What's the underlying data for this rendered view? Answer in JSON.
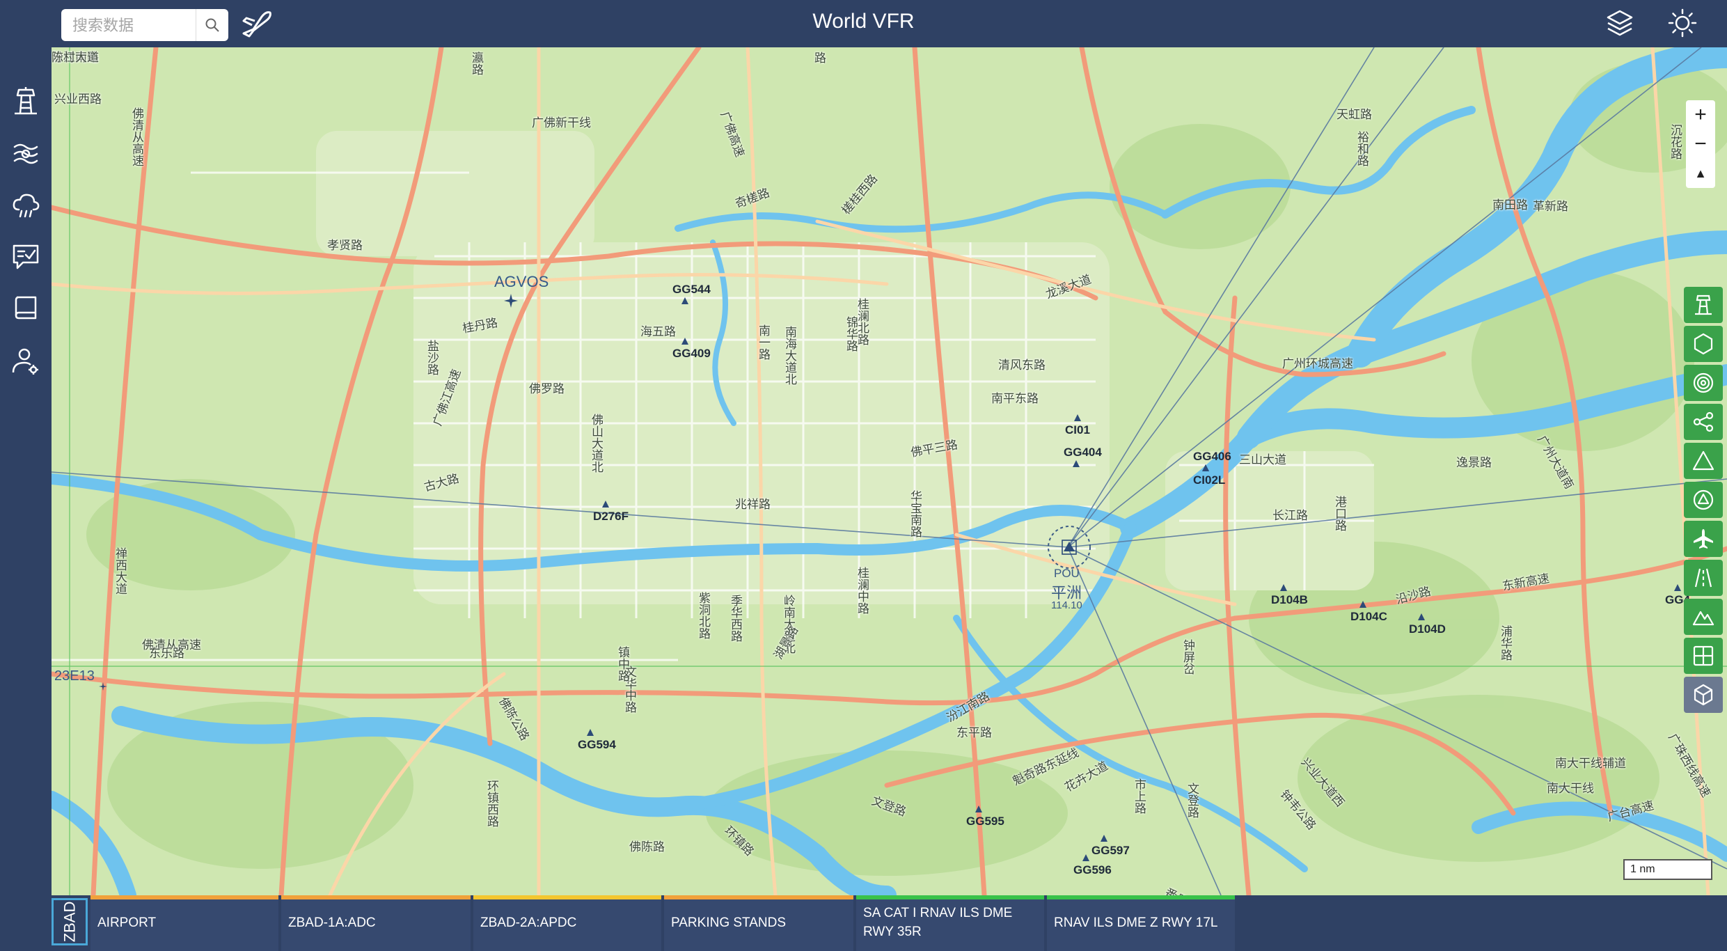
{
  "app": {
    "title": "World VFR"
  },
  "search": {
    "placeholder": "搜索数据"
  },
  "icons": {
    "search": "search-icon",
    "flight_plan": "plane-icon",
    "layers": "layers-icon",
    "theme": "sun-icon",
    "nav": [
      "airport-tower-icon",
      "weather-wind-icon",
      "cloud-rain-icon",
      "notes-check-icon",
      "book-icon",
      "user-settings-icon"
    ],
    "right_tools": [
      "tower-icon",
      "hexagon-icon",
      "target-icon",
      "share-nodes-icon",
      "triangle-icon",
      "triangle-circle-icon",
      "airplane-icon",
      "runway-icon",
      "mountain-icon",
      "grid-icon",
      "cube-icon"
    ]
  },
  "map": {
    "zoom_in": "+",
    "zoom_out": "−",
    "compass": "▲",
    "scale": "1 nm",
    "waypoints": [
      {
        "id": "AGVOS",
        "type": "intersection"
      },
      {
        "id": "GG544",
        "type": "vor"
      },
      {
        "id": "GG409",
        "type": "vor"
      },
      {
        "id": "D276F",
        "type": "dme"
      },
      {
        "id": "CI01",
        "type": "fix"
      },
      {
        "id": "GG404",
        "type": "fix"
      },
      {
        "id": "GG406",
        "type": "fix"
      },
      {
        "id": "CI02L",
        "type": "fix"
      },
      {
        "id": "D104B",
        "type": "dme"
      },
      {
        "id": "D104C",
        "type": "dme"
      },
      {
        "id": "D104D",
        "type": "dme"
      },
      {
        "id": "GG594",
        "type": "fix"
      },
      {
        "id": "GG595",
        "type": "fix"
      },
      {
        "id": "GG597",
        "type": "fix"
      },
      {
        "id": "GG596",
        "type": "fix"
      },
      {
        "id": "23E13",
        "type": "grid"
      },
      {
        "id": "GG4",
        "type": "fix"
      }
    ],
    "navaid": {
      "ident": "POU",
      "name": "平洲",
      "freq": "114.10"
    },
    "roads": [
      "兴业西路",
      "佛清从高速",
      "广佛新干线",
      "瀛路",
      "路",
      "广佛高速",
      "奇槎路",
      "槎桂西路",
      "孝贤路",
      "桂丹路",
      "海五路",
      "南一路",
      "南海大道北",
      "桂澜北路",
      "锦华路",
      "龙溪大道",
      "清风东路",
      "南平东路",
      "广州环城高速",
      "佛罗路",
      "佛山大道北",
      "佛平三路",
      "三山大道",
      "长江路",
      "港口路",
      "古大路",
      "兆祥路",
      "华宝南路",
      "桂澜中路",
      "广佛江高速",
      "盐沙路",
      "禅西大道",
      "佛清从高速",
      "紫洞北路",
      "季华西路",
      "岭南大道北",
      "文华中路",
      "湖景路",
      "汾江南路",
      "东平路",
      "魁奇路东延线",
      "花卉大道",
      "文登路",
      "文登路",
      "环镇路",
      "佛陈路",
      "天虹路",
      "裕和路",
      "南田路",
      "革新路",
      "沉花路",
      "逸景路",
      "广州大道南",
      "浦华路",
      "沿沙路",
      "东新高速",
      "南大干线辅道",
      "南大干线",
      "兴业大道西",
      "钟韦公路",
      "广台高速",
      "广珠西线高速",
      "钟屏岔",
      "市上路",
      "番禺大道",
      "环镇西路",
      "佛陈公路",
      "东乐路",
      "镇中路",
      "季华西路",
      "汾江南路",
      "陈村大道"
    ]
  },
  "bottom_tabs": {
    "airport_code": "ZBAD",
    "tabs": [
      {
        "label": "AIRPORT",
        "color": "#f0a13b"
      },
      {
        "label": "ZBAD-1A:ADC",
        "color": "#f0a13b"
      },
      {
        "label": "ZBAD-2A:APDC",
        "color": "#f3c62f"
      },
      {
        "label": "PARKING STANDS",
        "color": "#f0a13b"
      },
      {
        "label": "SA CAT I RNAV ILS DME RWY 35R",
        "color": "#39c24a"
      },
      {
        "label": "RNAV ILS DME Z RWY 17L",
        "color": "#39c24a"
      }
    ]
  }
}
